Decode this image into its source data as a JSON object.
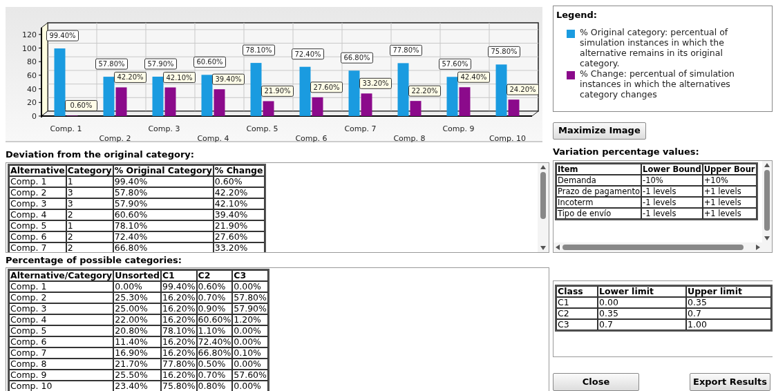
{
  "chart": {
    "chart_data": {
      "type": "bar",
      "categories": [
        "Comp. 1",
        "Comp. 2",
        "Comp. 3",
        "Comp. 4",
        "Comp. 5",
        "Comp. 6",
        "Comp. 7",
        "Comp. 8",
        "Comp. 9",
        "Comp. 10"
      ],
      "series": [
        {
          "color": "#1a9be0",
          "values": [
            99.4,
            57.8,
            57.9,
            60.6,
            78.1,
            72.4,
            66.8,
            77.8,
            57.6,
            75.8
          ],
          "value_labels": [
            "99.40%",
            "57.80%",
            "57.90%",
            "60.60%",
            "78.10%",
            "72.40%",
            "66.80%",
            "77.80%",
            "57.60%",
            "75.80%"
          ]
        },
        {
          "color": "#8b0a8b",
          "values": [
            0.6,
            42.2,
            42.1,
            39.4,
            21.9,
            27.6,
            33.2,
            22.2,
            42.4,
            24.2
          ],
          "value_labels": [
            "0.60%",
            "42.20%",
            "42.10%",
            "39.40%",
            "21.90%",
            "27.60%",
            "33.20%",
            "22.20%",
            "42.40%",
            "24.20%"
          ]
        }
      ],
      "ylim": [
        0,
        130
      ],
      "yticks": [
        0,
        20,
        40,
        60,
        80,
        100,
        120
      ]
    }
  },
  "legend": {
    "title": "Legend:",
    "items": [
      {
        "text": "% Original category: percentual of simulation instances in which the alternative remains in its original category.",
        "color": "#1a9be0"
      },
      {
        "text": "% Change: percentual of simulation instances in which the alternatives category changes",
        "color": "#8b0a8b"
      }
    ]
  },
  "maximize_button": "Maximize Image",
  "deviation": {
    "title": "Deviation from the original category:",
    "columns": [
      "Alternative",
      "Category",
      "% Original Category",
      "% Change"
    ],
    "rows": [
      [
        "Comp. 1",
        "1",
        "99.40%",
        "0.60%"
      ],
      [
        "Comp. 2",
        "3",
        "57.80%",
        "42.20%"
      ],
      [
        "Comp. 3",
        "3",
        "57.90%",
        "42.10%"
      ],
      [
        "Comp. 4",
        "2",
        "60.60%",
        "39.40%"
      ],
      [
        "Comp. 5",
        "1",
        "78.10%",
        "21.90%"
      ],
      [
        "Comp. 6",
        "2",
        "72.40%",
        "27.60%"
      ],
      [
        "Comp. 7",
        "2",
        "66.80%",
        "33.20%"
      ]
    ]
  },
  "possible": {
    "title": "Percentage of possible categories:",
    "columns": [
      "Alternative/Category",
      "Unsorted",
      "C1",
      "C2",
      "C3"
    ],
    "rows": [
      [
        "Comp. 1",
        "0.00%",
        "99.40%",
        "0.60%",
        "0.00%"
      ],
      [
        "Comp. 2",
        "25.30%",
        "16.20%",
        "0.70%",
        "57.80%"
      ],
      [
        "Comp. 3",
        "25.00%",
        "16.20%",
        "0.90%",
        "57.90%"
      ],
      [
        "Comp. 4",
        "22.00%",
        "16.20%",
        "60.60%",
        "1.20%"
      ],
      [
        "Comp. 5",
        "20.80%",
        "78.10%",
        "1.10%",
        "0.00%"
      ],
      [
        "Comp. 6",
        "11.40%",
        "16.20%",
        "72.40%",
        "0.00%"
      ],
      [
        "Comp. 7",
        "16.90%",
        "16.20%",
        "66.80%",
        "0.10%"
      ],
      [
        "Comp. 8",
        "21.70%",
        "77.80%",
        "0.50%",
        "0.00%"
      ],
      [
        "Comp. 9",
        "25.50%",
        "16.20%",
        "0.70%",
        "57.60%"
      ],
      [
        "Comp. 10",
        "23.40%",
        "75.80%",
        "0.80%",
        "0.00%"
      ]
    ]
  },
  "variation": {
    "title": "Variation percentage values:",
    "columns": [
      "Item",
      "Lower Bound",
      "Upper Bour"
    ],
    "rows": [
      [
        "Demanda",
        "-10%",
        "+10%"
      ],
      [
        "Prazo de pagamento",
        "-1 levels",
        "+1 levels"
      ],
      [
        "Incoterm",
        "-1 levels",
        "+1 levels"
      ],
      [
        "Tipo de envío",
        "-1 levels",
        "+1 levels"
      ]
    ]
  },
  "classes": {
    "columns": [
      "Class",
      "Lower limit",
      "Upper limit"
    ],
    "rows": [
      [
        "C1",
        "0.00",
        "0.35"
      ],
      [
        "C2",
        "0.35",
        "0.7"
      ],
      [
        "C3",
        "0.7",
        "1.00"
      ]
    ]
  },
  "buttons": [
    "Close",
    "Export Results"
  ]
}
